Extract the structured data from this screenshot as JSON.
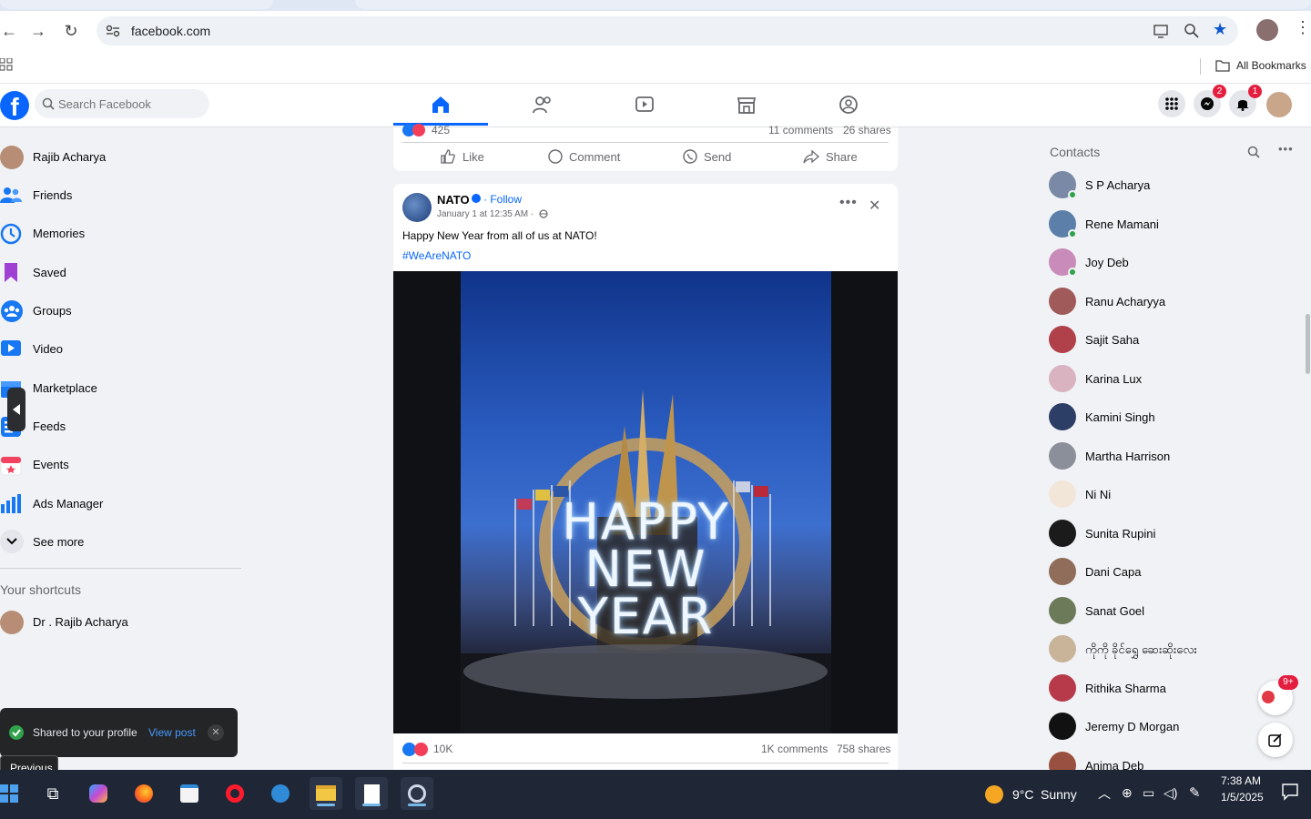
{
  "browser": {
    "url": "facebook.com",
    "all_bookmarks_label": "All Bookmarks"
  },
  "header": {
    "search_placeholder": "Search Facebook",
    "messenger_badge": "2",
    "notifications_badge": "1"
  },
  "left_sidebar": {
    "items": [
      {
        "label": "Rajib Acharya",
        "icon": "profile-avatar"
      },
      {
        "label": "Friends",
        "icon": "friends-icon"
      },
      {
        "label": "Memories",
        "icon": "memories-icon"
      },
      {
        "label": "Saved",
        "icon": "saved-icon"
      },
      {
        "label": "Groups",
        "icon": "groups-icon"
      },
      {
        "label": "Video",
        "icon": "video-icon"
      },
      {
        "label": "Marketplace",
        "icon": "marketplace-icon"
      },
      {
        "label": "Feeds",
        "icon": "feeds-icon"
      },
      {
        "label": "Events",
        "icon": "events-icon"
      },
      {
        "label": "Ads Manager",
        "icon": "ads-manager-icon"
      },
      {
        "label": "See more",
        "icon": "chevron-down-icon"
      }
    ],
    "shortcuts_title": "Your shortcuts",
    "shortcuts": [
      {
        "label": "Dr . Rajib Acharya"
      }
    ]
  },
  "post_top": {
    "reaction_count": "425",
    "comments": "11 comments",
    "shares": "26 shares",
    "actions": {
      "like": "Like",
      "comment": "Comment",
      "send": "Send",
      "share": "Share"
    }
  },
  "post": {
    "author": "NATO",
    "follow_label": "· Follow",
    "timestamp": "January 1 at 12:35 AM ·",
    "text": "Happy New Year from all of us at NATO!",
    "hashtag": "#WeAreNATO",
    "image_text": [
      "HAPPY",
      "NEW",
      "YEAR"
    ],
    "reaction_count": "10K",
    "comments": "1K comments",
    "shares": "758 shares"
  },
  "contacts": {
    "title": "Contacts",
    "items": [
      {
        "name": "S P Acharya",
        "online": true,
        "color": "#7a8aa6"
      },
      {
        "name": "Rene Mamani",
        "online": true,
        "color": "#5b7fa8"
      },
      {
        "name": "Joy Deb",
        "online": true,
        "color": "#c98bb9"
      },
      {
        "name": "Ranu Acharyya",
        "online": false,
        "color": "#a05a5a"
      },
      {
        "name": "Sajit Saha",
        "online": false,
        "color": "#b0404a"
      },
      {
        "name": "Karina Lux",
        "online": false,
        "color": "#d9b3c0"
      },
      {
        "name": "Kamini Singh",
        "online": false,
        "color": "#2d3e66"
      },
      {
        "name": "Martha Harrison",
        "online": false,
        "color": "#8a8f99"
      },
      {
        "name": "Ni Ni",
        "online": false,
        "color": "#f2e6d9"
      },
      {
        "name": "Sunita Rupini",
        "online": false,
        "color": "#1b1b1b"
      },
      {
        "name": "Dani Capa",
        "online": false,
        "color": "#8f6d5a"
      },
      {
        "name": "Sanat Goel",
        "online": false,
        "color": "#6c7a5a"
      },
      {
        "name": "ကိုကို ခိုင်ရွှေ ဆေးဆိုးလေး",
        "online": false,
        "color": "#c9b49a"
      },
      {
        "name": "Rithika Sharma",
        "online": false,
        "color": "#b63a4a"
      },
      {
        "name": "Jeremy D Morgan",
        "online": false,
        "color": "#111111"
      },
      {
        "name": "Anima Deb",
        "online": false,
        "color": "#9a5040"
      }
    ]
  },
  "toast": {
    "message": "Shared to your profile",
    "link": "View post"
  },
  "tooltip": "Previous",
  "chat_bubble_badge": "9+",
  "taskbar": {
    "temperature": "9°C",
    "weather": "Sunny",
    "time": "7:38 AM",
    "date": "1/5/2025"
  },
  "colors": {
    "fb_blue": "#0866ff",
    "badge_red": "#e41e3f",
    "online_green": "#31a24c"
  }
}
